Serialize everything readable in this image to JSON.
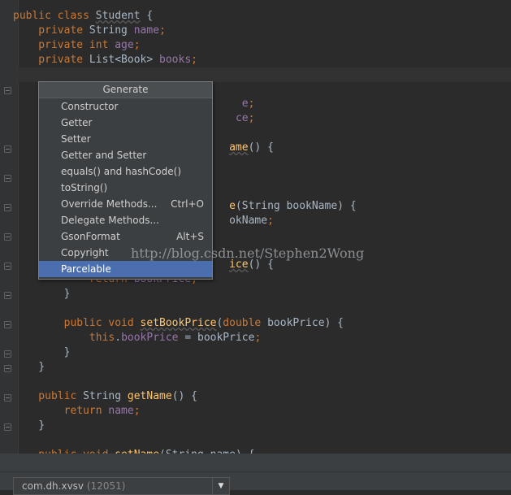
{
  "code_lines": [
    [
      {
        "t": "public ",
        "c": "kw"
      },
      {
        "t": "class ",
        "c": "kw"
      },
      {
        "t": "Student",
        "c": "ul"
      },
      {
        "t": " {",
        "c": ""
      }
    ],
    [
      {
        "t": "    private ",
        "c": "kw"
      },
      {
        "t": "String ",
        "c": ""
      },
      {
        "t": "name",
        "c": "fld"
      },
      {
        "t": ";",
        "c": "kw"
      }
    ],
    [
      {
        "t": "    private ",
        "c": "kw"
      },
      {
        "t": "int ",
        "c": "kw"
      },
      {
        "t": "age",
        "c": "fld"
      },
      {
        "t": ";",
        "c": "kw"
      }
    ],
    [
      {
        "t": "    private ",
        "c": "kw"
      },
      {
        "t": "List<Book> ",
        "c": ""
      },
      {
        "t": "books",
        "c": "fld"
      },
      {
        "t": ";",
        "c": "kw"
      }
    ],
    [],
    [],
    [
      {
        "t": "                                    ",
        "c": ""
      },
      {
        "t": "e",
        "c": "fld"
      },
      {
        "t": ";",
        "c": "kw"
      }
    ],
    [
      {
        "t": "                                   ",
        "c": ""
      },
      {
        "t": "ce",
        "c": "fld"
      },
      {
        "t": ";",
        "c": "kw"
      }
    ],
    [],
    [
      {
        "t": "                                  ",
        "c": ""
      },
      {
        "t": "ame",
        "c": "fn ul"
      },
      {
        "t": "() {",
        "c": ""
      }
    ],
    [],
    [],
    [],
    [
      {
        "t": "                                  ",
        "c": ""
      },
      {
        "t": "e",
        "c": "fn"
      },
      {
        "t": "(String bookName) {",
        "c": ""
      }
    ],
    [
      {
        "t": "                                  ",
        "c": ""
      },
      {
        "t": "okName",
        "c": ""
      },
      {
        "t": ";",
        "c": "kw"
      }
    ],
    [],
    [],
    [
      {
        "t": "                                  ",
        "c": ""
      },
      {
        "t": "ice",
        "c": "fn ul"
      },
      {
        "t": "() {",
        "c": ""
      }
    ],
    [
      {
        "t": "            return ",
        "c": "kw"
      },
      {
        "t": "bookPrice",
        "c": "fld"
      },
      {
        "t": ";",
        "c": "kw"
      }
    ],
    [
      {
        "t": "        }",
        "c": ""
      }
    ],
    [],
    [
      {
        "t": "        public ",
        "c": "kw"
      },
      {
        "t": "void ",
        "c": "kw"
      },
      {
        "t": "setBookPrice",
        "c": "fn ul"
      },
      {
        "t": "(",
        "c": ""
      },
      {
        "t": "double ",
        "c": "kw"
      },
      {
        "t": "bookPrice) {",
        "c": ""
      }
    ],
    [
      {
        "t": "            this",
        "c": "kw"
      },
      {
        "t": ".",
        "c": ""
      },
      {
        "t": "bookPrice",
        "c": "fld"
      },
      {
        "t": " = bookPrice",
        "c": ""
      },
      {
        "t": ";",
        "c": "kw"
      }
    ],
    [
      {
        "t": "        }",
        "c": ""
      }
    ],
    [
      {
        "t": "    }",
        "c": ""
      }
    ],
    [],
    [
      {
        "t": "    public ",
        "c": "kw"
      },
      {
        "t": "String ",
        "c": ""
      },
      {
        "t": "getName",
        "c": "fn"
      },
      {
        "t": "() {",
        "c": ""
      }
    ],
    [
      {
        "t": "        return ",
        "c": "kw"
      },
      {
        "t": "name",
        "c": "fld"
      },
      {
        "t": ";",
        "c": "kw"
      }
    ],
    [
      {
        "t": "    }",
        "c": ""
      }
    ],
    [],
    [
      {
        "t": "    public ",
        "c": "kw"
      },
      {
        "t": "void ",
        "c": "kw"
      },
      {
        "t": "setName",
        "c": "fn"
      },
      {
        "t": "(String name) {",
        "c": ""
      }
    ]
  ],
  "popup": {
    "title": "Generate",
    "items": [
      {
        "label": "Constructor",
        "shortcut": ""
      },
      {
        "label": "Getter",
        "shortcut": ""
      },
      {
        "label": "Setter",
        "shortcut": ""
      },
      {
        "label": "Getter and Setter",
        "shortcut": ""
      },
      {
        "label": "equals() and hashCode()",
        "shortcut": ""
      },
      {
        "label": "toString()",
        "shortcut": ""
      },
      {
        "label": "Override Methods...",
        "shortcut": "Ctrl+O"
      },
      {
        "label": "Delegate Methods...",
        "shortcut": ""
      },
      {
        "label": "GsonFormat",
        "shortcut": "Alt+S"
      },
      {
        "label": "Copyright",
        "shortcut": ""
      },
      {
        "label": "Parcelable",
        "shortcut": ""
      }
    ],
    "selected_index": 10
  },
  "watermark": "http://blog.csdn.net/Stephen2Wong",
  "status": {
    "package": "com.dh.xvsv",
    "count": "(12051)"
  },
  "colors": {
    "background": "#2b2b2b",
    "keyword": "#cc7832",
    "field": "#9876aa",
    "method": "#ffc66d",
    "selection": "#4b6eaf"
  }
}
